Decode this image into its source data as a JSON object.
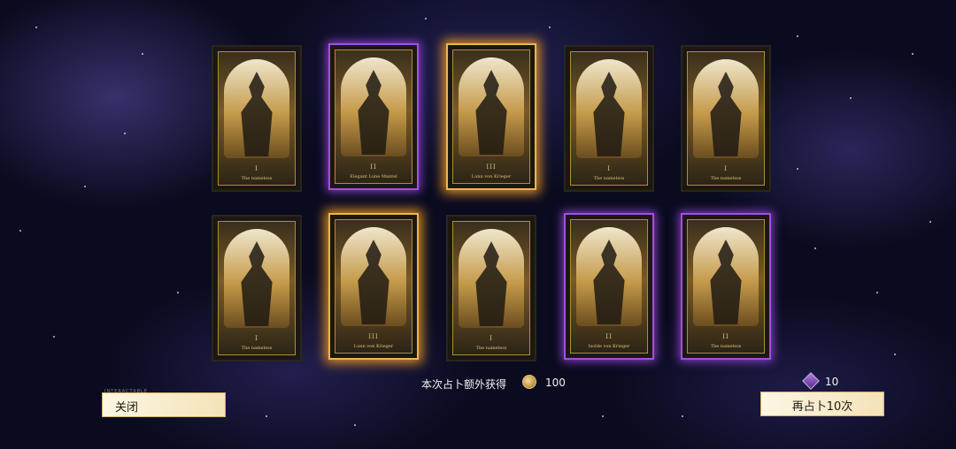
{
  "cards": [
    {
      "numeral": "I",
      "name": "The nameless",
      "rarity": "normal"
    },
    {
      "numeral": "II",
      "name": "Elegant Lune Mantel",
      "rarity": "purple"
    },
    {
      "numeral": "III",
      "name": "Lunn von Krieger",
      "rarity": "gold"
    },
    {
      "numeral": "I",
      "name": "The nameless",
      "rarity": "normal"
    },
    {
      "numeral": "I",
      "name": "The nameless",
      "rarity": "normal"
    },
    {
      "numeral": "I",
      "name": "The nameless",
      "rarity": "normal"
    },
    {
      "numeral": "III",
      "name": "Lunn von Krieger",
      "rarity": "gold"
    },
    {
      "numeral": "I",
      "name": "The nameless",
      "rarity": "normal"
    },
    {
      "numeral": "II",
      "name": "Isolde von Krieger",
      "rarity": "purple"
    },
    {
      "numeral": "II",
      "name": "The nameless",
      "rarity": "purple"
    }
  ],
  "reward": {
    "label": "本次占卜额外获得",
    "amount": "100",
    "icon": "gold-coin-icon"
  },
  "ticket": {
    "count": "10",
    "icon": "purple-ticket-icon"
  },
  "buttons": {
    "close": "关闭",
    "close_caption": "INTERACTABLE",
    "draw_again": "再占卜10次"
  },
  "colors": {
    "gold_glow": "#f0b548",
    "purple_glow": "#a44de6",
    "button_bg": "#fdf6e3"
  }
}
